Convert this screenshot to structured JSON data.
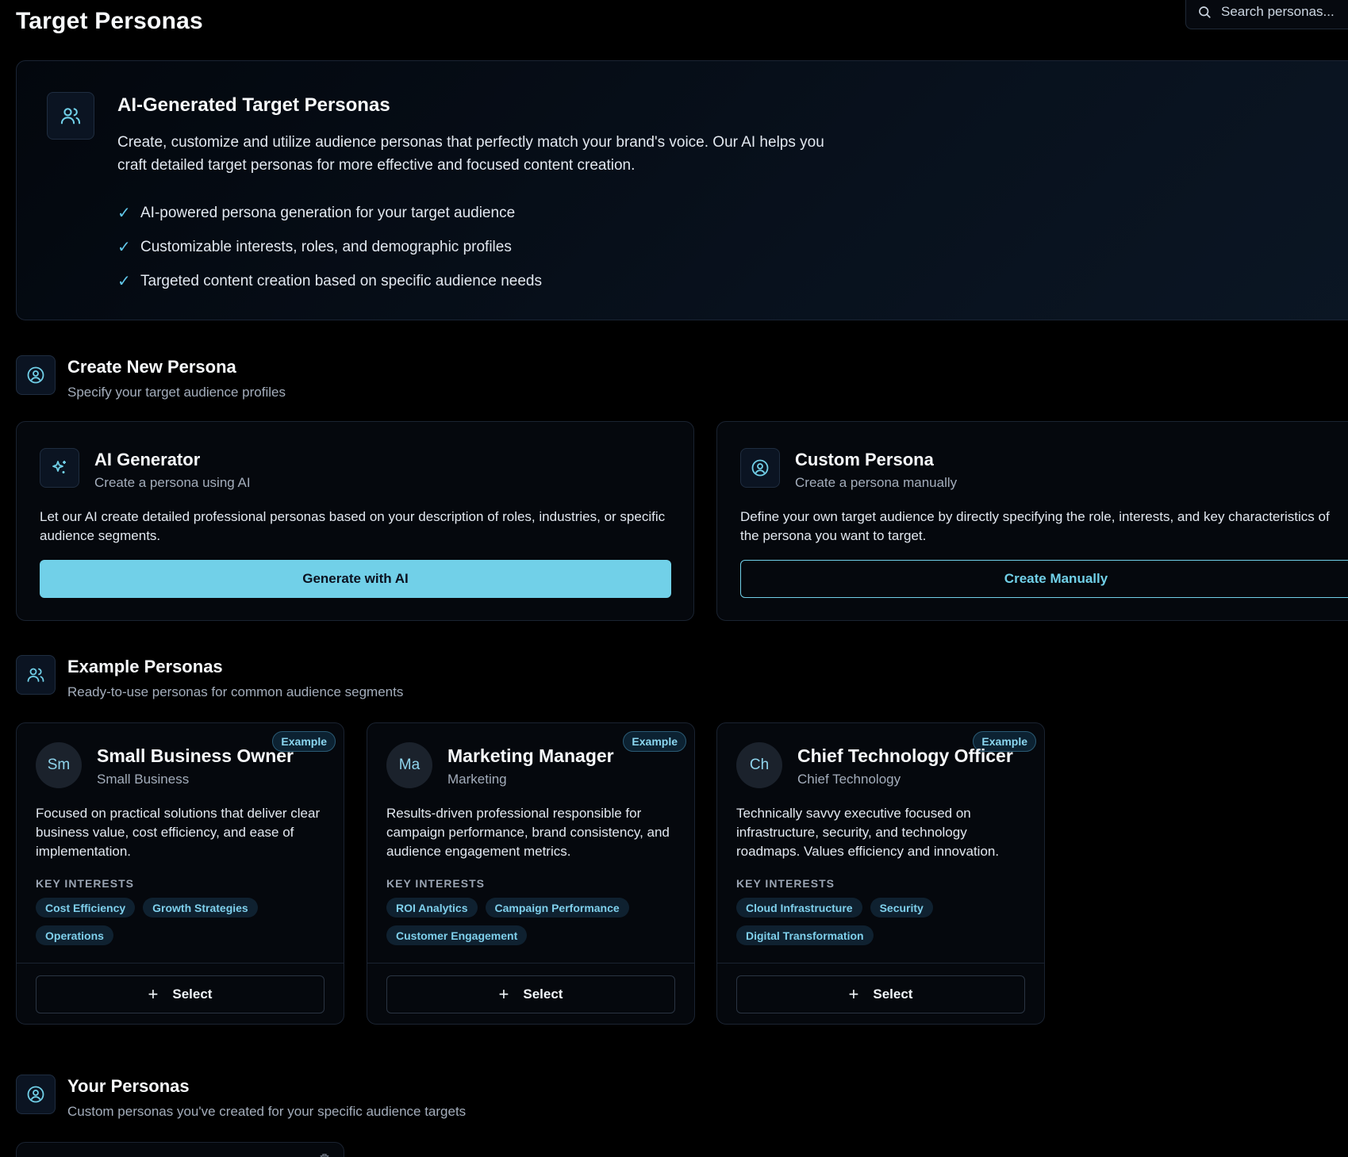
{
  "header": {
    "title": "Target Personas",
    "search_placeholder": "Search personas..."
  },
  "hero": {
    "title": "AI-Generated Target Personas",
    "description": "Create, customize and utilize audience personas that perfectly match your brand's voice. Our AI helps you craft detailed target personas for more effective and focused content creation.",
    "features": [
      "AI-powered persona generation for your target audience",
      "Customizable interests, roles, and demographic profiles",
      "Targeted content creation based on specific audience needs"
    ]
  },
  "create_section": {
    "title": "Create New Persona",
    "subtitle": "Specify your target audience profiles",
    "ai_card": {
      "title": "AI Generator",
      "subtitle": "Create a persona using AI",
      "description": "Let our AI create detailed professional personas based on your description of roles, industries, or specific audience segments.",
      "button": "Generate with AI"
    },
    "custom_card": {
      "title": "Custom Persona",
      "subtitle": "Create a persona manually",
      "description": "Define your own target audience by directly specifying the role, interests, and key characteristics of the persona you want to target.",
      "button": "Create Manually"
    }
  },
  "examples_section": {
    "title": "Example Personas",
    "subtitle": "Ready-to-use personas for common audience segments",
    "interests_label": "KEY INTERESTS",
    "badge": "Example",
    "select_label": "Select",
    "personas": [
      {
        "initials": "Sm",
        "name": "Small Business Owner",
        "role": "Small Business",
        "description": "Focused on practical solutions that deliver clear business value, cost efficiency, and ease of implementation.",
        "interests": [
          "Cost Efficiency",
          "Growth Strategies",
          "Operations"
        ]
      },
      {
        "initials": "Ma",
        "name": "Marketing Manager",
        "role": "Marketing",
        "description": "Results-driven professional responsible for campaign performance, brand consistency, and audience engagement metrics.",
        "interests": [
          "ROI Analytics",
          "Campaign Performance",
          "Customer Engagement"
        ]
      },
      {
        "initials": "Ch",
        "name": "Chief Technology Officer",
        "role": "Chief Technology",
        "description": "Technically savvy executive focused on infrastructure, security, and technology roadmaps. Values efficiency and innovation.",
        "interests": [
          "Cloud Infrastructure",
          "Security",
          "Digital Transformation"
        ]
      }
    ]
  },
  "your_section": {
    "title": "Your Personas",
    "subtitle": "Custom personas you've created for your specific audience targets"
  },
  "colors": {
    "accent": "#71d0e8",
    "background": "#000000",
    "card": "#05080d",
    "border": "#1a2331"
  }
}
